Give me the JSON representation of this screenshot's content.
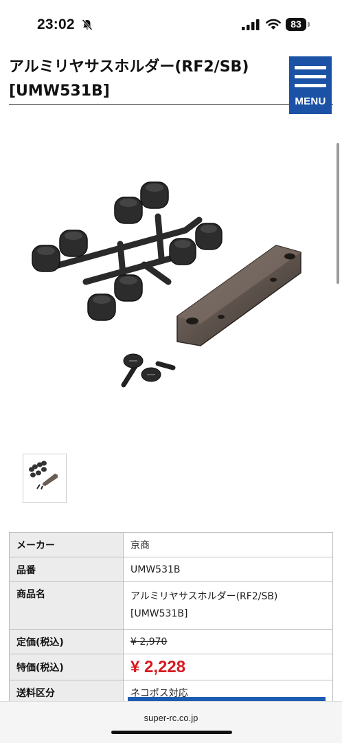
{
  "status_bar": {
    "time": "23:02",
    "battery_level": "83",
    "icons": [
      "bell-slash-icon",
      "signal-icon",
      "wifi-icon",
      "battery-icon"
    ]
  },
  "header": {
    "title": "アルミリヤサスホルダー(RF2/SB) [UMW531B]",
    "menu_label": "MENU",
    "menu_color": "#1c52a6"
  },
  "product": {
    "image_icon": "product-photo",
    "thumbnail_icon": "product-thumbnail"
  },
  "spec_table": {
    "rows": [
      {
        "label": "メーカー",
        "value": "京商"
      },
      {
        "label": "品番",
        "value": "UMW531B"
      },
      {
        "label": "商品名",
        "value": "アルミリヤサスホルダー(RF2/SB)",
        "value2": "[UMW531B]"
      },
      {
        "label": "定価(税込)",
        "value": "¥ 2,970"
      },
      {
        "label": "特価(税込)",
        "value": "¥ 2,228"
      },
      {
        "label": "送料区分",
        "value": "ネコポス対応"
      }
    ],
    "sale_color": "#d71920"
  },
  "browser": {
    "url": "super-rc.co.jp"
  }
}
